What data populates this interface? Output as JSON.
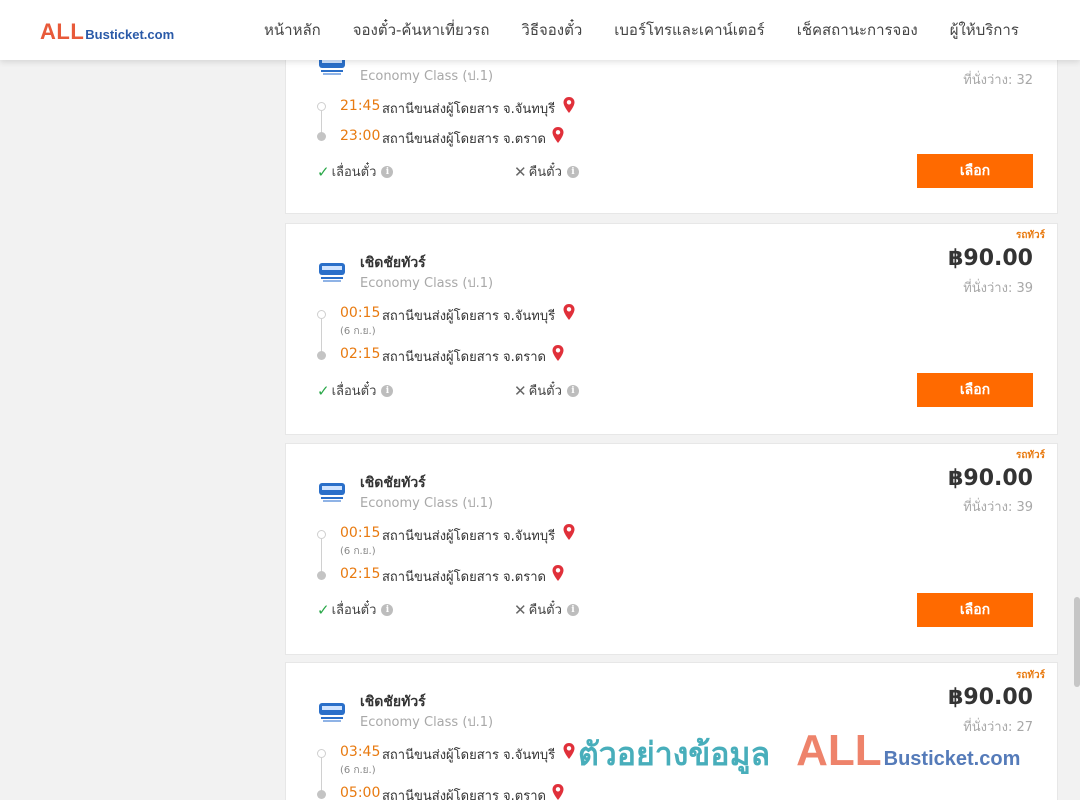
{
  "header": {
    "logo_main": "ALL",
    "logo_sub": "Busticket.com",
    "nav": [
      {
        "label": "หน้าหลัก"
      },
      {
        "label": "จองตั๋ว-ค้นหาเที่ยวรถ"
      },
      {
        "label": "วิธีจองตั๋ว"
      },
      {
        "label": "เบอร์โทรและเคาน์เตอร์"
      },
      {
        "label": "เช็คสถานะการจอง"
      },
      {
        "label": "ผู้ให้บริการ"
      }
    ]
  },
  "trips": [
    {
      "operator": "",
      "class": "Economy Class (ป.1)",
      "badge": "",
      "price": "",
      "seats": "ที่นั่งว่าง: 32",
      "depart_time": "21:45",
      "depart_station": "สถานีขนส่งผู้โดยสาร จ.จันทบุรี",
      "depart_note": "",
      "arrive_time": "23:00",
      "arrive_station": "สถานีขนส่งผู้โดยสาร จ.ตราด",
      "change_label": "เลื่อนตั๋ว",
      "refund_label": "คืนตั๋ว",
      "select_label": "เลือก"
    },
    {
      "operator": "เชิดชัยทัวร์",
      "class": "Economy Class (ป.1)",
      "badge": "รถทัวร์",
      "price": "฿90.00",
      "seats": "ที่นั่งว่าง: 39",
      "depart_time": "00:15",
      "depart_station": "สถานีขนส่งผู้โดยสาร จ.จันทบุรี",
      "depart_note": "(6 ก.ย.)",
      "arrive_time": "02:15",
      "arrive_station": "สถานีขนส่งผู้โดยสาร จ.ตราด",
      "change_label": "เลื่อนตั๋ว",
      "refund_label": "คืนตั๋ว",
      "select_label": "เลือก"
    },
    {
      "operator": "เชิดชัยทัวร์",
      "class": "Economy Class (ป.1)",
      "badge": "รถทัวร์",
      "price": "฿90.00",
      "seats": "ที่นั่งว่าง: 39",
      "depart_time": "00:15",
      "depart_station": "สถานีขนส่งผู้โดยสาร จ.จันทบุรี",
      "depart_note": "(6 ก.ย.)",
      "arrive_time": "02:15",
      "arrive_station": "สถานีขนส่งผู้โดยสาร จ.ตราด",
      "change_label": "เลื่อนตั๋ว",
      "refund_label": "คืนตั๋ว",
      "select_label": "เลือก"
    },
    {
      "operator": "เชิดชัยทัวร์",
      "class": "Economy Class (ป.1)",
      "badge": "รถทัวร์",
      "price": "฿90.00",
      "seats": "ที่นั่งว่าง: 27",
      "depart_time": "03:45",
      "depart_station": "สถานีขนส่งผู้โดยสาร จ.จันทบุรี",
      "depart_note": "(6 ก.ย.)",
      "arrive_time": "05:00",
      "arrive_station": "สถานีขนส่งผู้โดยสาร จ.ตราด",
      "change_label": "",
      "refund_label": "",
      "select_label": ""
    }
  ],
  "watermark": {
    "text": "ตัวอย่างข้อมูล",
    "logo_main": "ALL",
    "logo_sub": "Busticket.com"
  },
  "colors": {
    "accent": "#ff6a00",
    "time": "#e87a10",
    "pin": "#e0303a",
    "check": "#2ba84a"
  }
}
